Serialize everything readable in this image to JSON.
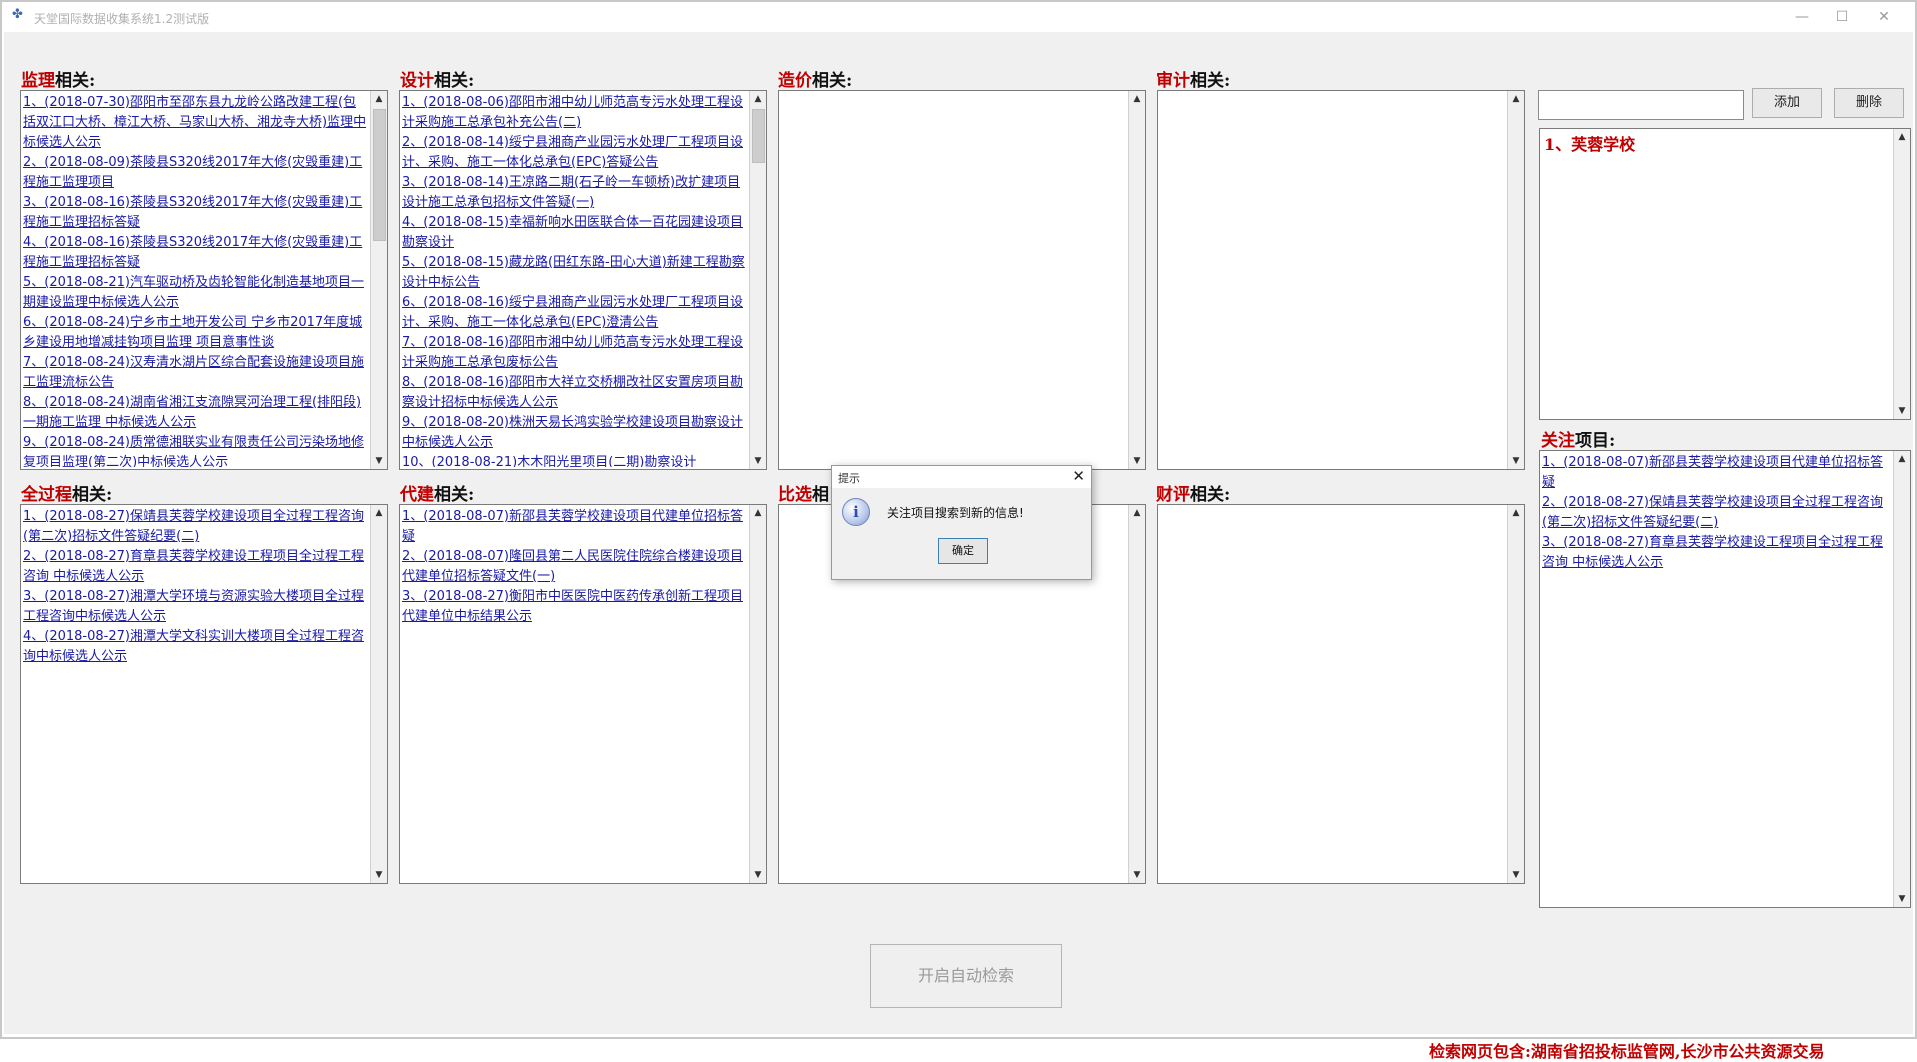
{
  "window": {
    "title": "天堂国际数据收集系统1.2测试版",
    "minimize": "—",
    "maximize": "☐",
    "close": "✕"
  },
  "sections": {
    "jianli": {
      "label_red": "监理",
      "label_black": "相关:",
      "items": [
        "1、(2018-07-30)邵阳市至邵东县九龙岭公路改建工程(包括双江口大桥、樟江大桥、马家山大桥、湘龙寺大桥)监理中标候选人公示",
        "2、(2018-08-09)茶陵县S320线2017年大修(灾毁重建)工程施工监理项目",
        "3、(2018-08-16)茶陵县S320线2017年大修(灾毁重建)工程施工监理招标答疑",
        "4、(2018-08-16)茶陵县S320线2017年大修(灾毁重建)工程施工监理招标答疑",
        "5、(2018-08-21)汽车驱动桥及齿轮智能化制造基地项目一期建设监理中标候选人公示",
        "6、(2018-08-24)宁乡市土地开发公司 宁乡市2017年度城乡建设用地增减挂钩项目监理 项目意事性谈",
        "7、(2018-08-24)汉寿清水湖片区综合配套设施建设项目施工监理流标公告",
        "8、(2018-08-24)湖南省湘江支流隙冥河治理工程(排阳段)一期施工监理 中标候选人公示",
        "9、(2018-08-24)质常德湘联实业有限责任公司污染场地修复项目监理(第二次)中标候选人公示"
      ]
    },
    "sheji": {
      "label_red": "设计",
      "label_black": "相关:",
      "items": [
        "1、(2018-08-06)邵阳市湘中幼儿师范高专污水处理工程设计采购施工总承包补充公告(二)",
        "2、(2018-08-14)绥宁县湘商产业园污水处理厂工程项目设计、采购、施工一体化总承包(EPC)答疑公告",
        "3、(2018-08-14)王凉路二期(石子岭一车顿桥)改扩建项目设计施工总承包招标文件答疑(一)",
        "4、(2018-08-15)幸福新响水田医联合体一百花园建设项目勘察设计",
        "5、(2018-08-15)藏龙路(田红东路-田心大道)新建工程勘察设计中标公告",
        "6、(2018-08-16)绥宁县湘商产业园污水处理厂工程项目设计、采购、施工一体化总承包(EPC)澄清公告",
        "7、(2018-08-16)邵阳市湘中幼儿师范高专污水处理工程设计采购施工总承包废标公告",
        "8、(2018-08-16)邵阳市大祥立交桥棚改社区安置房项目勘察设计招标中标候选人公示",
        "9、(2018-08-20)株洲天易长鸿实验学校建设项目勘察设计中标候选人公示",
        "10、(2018-08-21)木木阳光里项目(二期)勘察设计"
      ]
    },
    "zaojia": {
      "label_red": "造价",
      "label_black": "相关:"
    },
    "shenji": {
      "label_red": "审计",
      "label_black": "相关:"
    },
    "quanguocheng": {
      "label_red": "全过程",
      "label_black": "相关:",
      "items": [
        "1、(2018-08-27)保靖县芙蓉学校建设项目全过程工程咨询(第二次)招标文件答疑纪要(二)",
        "2、(2018-08-27)育章县芙蓉学校建设工程项目全过程工程咨询 中标候选人公示",
        "3、(2018-08-27)湘潭大学环境与资源实验大楼项目全过程工程咨询中标候选人公示",
        "4、(2018-08-27)湘潭大学文科实训大楼项目全过程工程咨询中标候选人公示"
      ]
    },
    "daijian": {
      "label_red": "代建",
      "label_black": "相关:",
      "items": [
        "1、(2018-08-07)新邵县芙蓉学校建设项目代建单位招标答疑",
        "2、(2018-08-07)隆回县第二人民医院住院综合楼建设项目代建单位招标答疑文件(一)",
        "3、(2018-08-27)衡阳市中医医院中医药传承创新工程项目代建单位中标结果公示"
      ]
    },
    "bixuan": {
      "label_red": "比选",
      "label_black": "相"
    },
    "caiping": {
      "label_red": "财评",
      "label_black": "相关:"
    }
  },
  "keyword_panel": {
    "input_value": "",
    "add_button": "添加",
    "delete_button": "删除",
    "items": [
      "1、芙蓉学校"
    ]
  },
  "focus_projects": {
    "label_red": "关注",
    "label_black": "项目:",
    "items": [
      "1、(2018-08-07)新邵县芙蓉学校建设项目代建单位招标答疑",
      "2、(2018-08-27)保靖县芙蓉学校建设项目全过程工程咨询(第二次)招标文件答疑纪要(二)",
      "3、(2018-08-27)育章县芙蓉学校建设工程项目全过程工程咨询 中标候选人公示"
    ]
  },
  "auto_search_button": "开启自动检索",
  "footer": "检索网页包含:湖南省招投标监管网,长沙市公共资源交易",
  "dialog": {
    "title": "提示",
    "icon_glyph": "i",
    "message": "关注项目搜索到新的信息!",
    "ok": "确定",
    "close": "✕"
  },
  "arrows": {
    "up": "▲",
    "down": "▼"
  }
}
